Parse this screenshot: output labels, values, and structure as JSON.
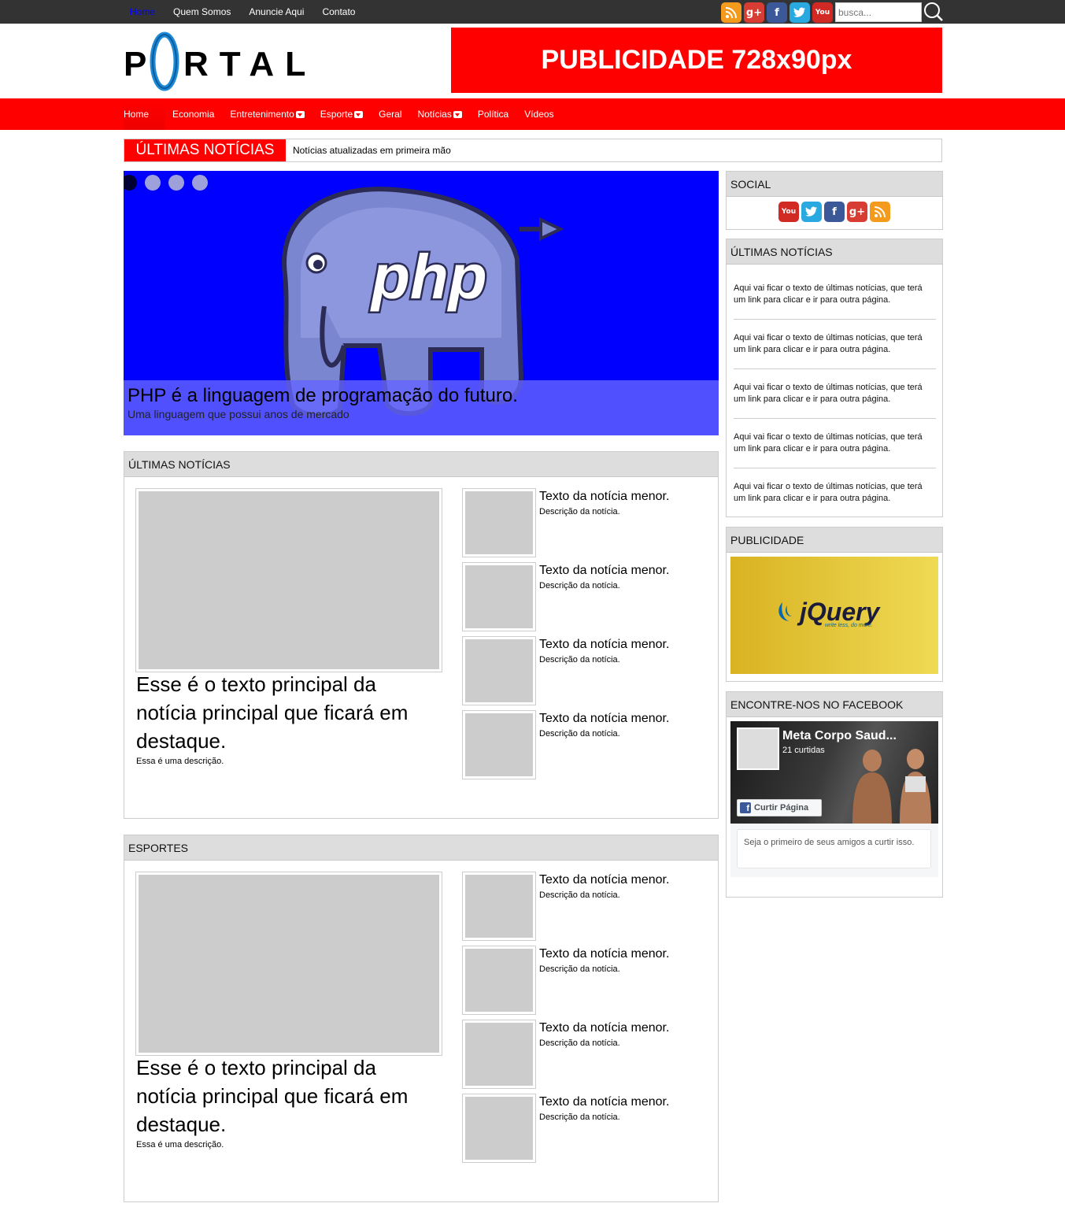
{
  "top_nav": [
    "Home",
    "Quem Somos",
    "Anuncie Aqui",
    "Contato"
  ],
  "top_social_icons": [
    "rss-icon",
    "google-plus-icon",
    "facebook-icon",
    "twitter-icon",
    "youtube-icon"
  ],
  "search": {
    "placeholder": "busca..."
  },
  "logo_text": "PORTAL",
  "banner_text": "PUBLICIDADE 728x90px",
  "main_nav": [
    {
      "label": "Home",
      "dropdown": false
    },
    {
      "label": "Economia",
      "dropdown": false
    },
    {
      "label": "Entretenimento",
      "dropdown": true
    },
    {
      "label": "Esporte",
      "dropdown": true
    },
    {
      "label": "Geral",
      "dropdown": false
    },
    {
      "label": "Notícias",
      "dropdown": true
    },
    {
      "label": "Política",
      "dropdown": false
    },
    {
      "label": "Vídeos",
      "dropdown": false
    }
  ],
  "ticker": {
    "label": "ÚLTIMAS NOTÍCIAS",
    "text": "Notícias atualizadas em primeira mão"
  },
  "slider": {
    "logo_text": "php",
    "title": "PHP é a linguagem de programação do futuro.",
    "subtitle": "Uma linguagem que possui anos de mercado",
    "dots": 4,
    "active_dot": 0
  },
  "sections": [
    {
      "title": "ÚLTIMAS NOTÍCIAS",
      "featured_title": "Esse é o texto principal da notícia principal que ficará em destaque.",
      "featured_desc": "Essa é uma descrição.",
      "items": [
        {
          "title": "Texto da notícia menor.",
          "desc": "Descrição da notícia."
        },
        {
          "title": "Texto da notícia menor.",
          "desc": "Descrição da notícia."
        },
        {
          "title": "Texto da notícia menor.",
          "desc": "Descrição da notícia."
        },
        {
          "title": "Texto da notícia menor.",
          "desc": "Descrição da notícia."
        }
      ]
    },
    {
      "title": "ESPORTES",
      "featured_title": "Esse é o texto principal da notícia principal que ficará em destaque.",
      "featured_desc": "Essa é uma descrição.",
      "items": [
        {
          "title": "Texto da notícia menor.",
          "desc": "Descrição da notícia."
        },
        {
          "title": "Texto da notícia menor.",
          "desc": "Descrição da notícia."
        },
        {
          "title": "Texto da notícia menor.",
          "desc": "Descrição da notícia."
        },
        {
          "title": "Texto da notícia menor.",
          "desc": "Descrição da notícia."
        }
      ]
    }
  ],
  "sidebar": {
    "social_title": "SOCIAL",
    "social_icons": [
      "youtube-icon",
      "twitter-icon",
      "facebook-icon",
      "google-plus-icon",
      "rss-icon"
    ],
    "news_title": "ÚLTIMAS NOTÍCIAS",
    "news_items": [
      "Aqui vai ficar o texto de últimas notícias, que terá um link para clicar e ir para outra página.",
      "Aqui vai ficar o texto de últimas notícias, que terá um link para clicar e ir para outra página.",
      "Aqui vai ficar o texto de últimas notícias, que terá um link para clicar e ir para outra página.",
      "Aqui vai ficar o texto de últimas notícias, que terá um link para clicar e ir para outra página.",
      "Aqui vai ficar o texto de últimas notícias, que terá um link para clicar e ir para outra página."
    ],
    "ad_title": "PUBLICIDADE",
    "ad_brand": "jQuery",
    "ad_tagline": "write less, do more.",
    "facebook_title": "ENCONTRE-NOS NO FACEBOOK",
    "facebook": {
      "page_name": "Meta Corpo Saud...",
      "likes": "21 curtidas",
      "like_button": "Curtir Página",
      "message": "Seja o primeiro de seus amigos a curtir isso."
    }
  },
  "colors": {
    "accent": "#ff0000",
    "topbar": "#333333",
    "slider_bg": "#0000ff"
  }
}
